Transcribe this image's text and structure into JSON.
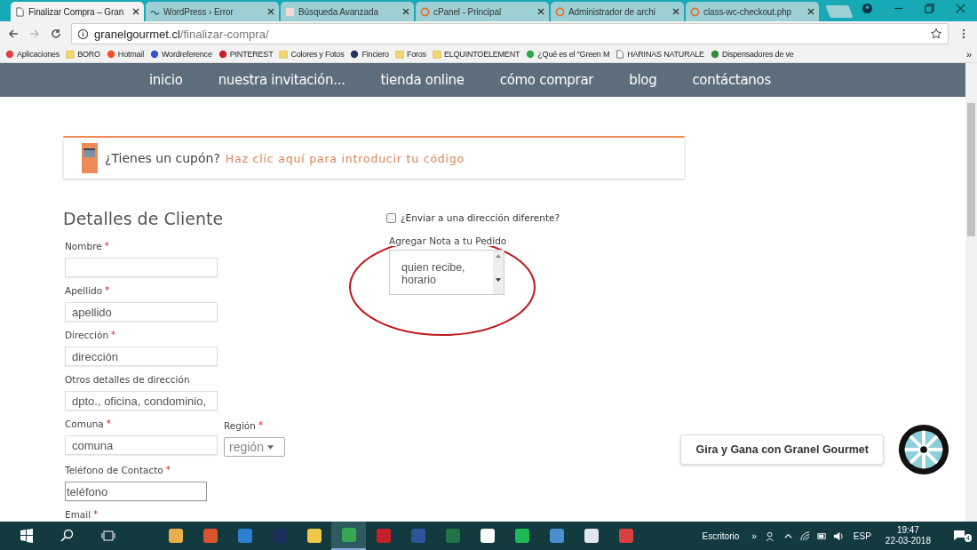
{
  "browser": {
    "tabs": [
      {
        "title": "Finalizar Compra – Gran",
        "kind": "page",
        "selected": true
      },
      {
        "title": "WordPress › Error",
        "kind": "wave",
        "selected": false
      },
      {
        "title": "Búsqueda Avanzada",
        "kind": "w",
        "selected": false
      },
      {
        "title": "cPanel - Principal",
        "kind": "cp",
        "selected": false
      },
      {
        "title": "Administrador de archi",
        "kind": "cp",
        "selected": false
      },
      {
        "title": "class-wc-checkout.php",
        "kind": "cp",
        "selected": false
      }
    ],
    "url_host": "granelgourmet.cl",
    "url_path": "/finalizar-compra/",
    "bookmarks": [
      {
        "label": "Aplicaciones",
        "kind": "apps"
      },
      {
        "label": "BORO",
        "kind": "folder"
      },
      {
        "label": "Hotmail",
        "kind": "windows"
      },
      {
        "label": "Wordreference",
        "kind": "wr"
      },
      {
        "label": "PINTEREST",
        "kind": "pin"
      },
      {
        "label": "Colores y Fotos",
        "kind": "folder"
      },
      {
        "label": "Finciero",
        "kind": "f"
      },
      {
        "label": "Foros",
        "kind": "folder"
      },
      {
        "label": "ELQUINTOELEMENT",
        "kind": "folder"
      },
      {
        "label": "¿Qué es el \"Green M",
        "kind": "circle"
      },
      {
        "label": "HARINAS NATURALE",
        "kind": "page"
      },
      {
        "label": "Dispensadores de ve",
        "kind": "green"
      }
    ],
    "bookmarks_more": "»"
  },
  "nav": [
    "inicio",
    "nuestra invitación...",
    "tienda online",
    "cómo comprar",
    "blog",
    "contáctanos"
  ],
  "coupon": {
    "question": "¿Tienes un cupón?",
    "link": "Haz clic aquí para introducir tu código"
  },
  "form": {
    "heading": "Detalles de Cliente",
    "fields": [
      {
        "label": "Nombre",
        "required_mark": "*"
      },
      {
        "label": "Apellido",
        "required_mark": "*",
        "placeholder": "apellido"
      },
      {
        "label": "Dirección",
        "required_mark": "*",
        "placeholder": "dirección"
      },
      {
        "label": "Otros detalles de dirección",
        "placeholder": "dpto., oficina, condominio,"
      }
    ],
    "comuna": {
      "label": "Comuna",
      "required_mark": "*",
      "placeholder": "comuna"
    },
    "region": {
      "label": "Región",
      "required_mark": "*",
      "value": "región"
    },
    "phone": {
      "label": "Teléfono de Contacto",
      "required_mark": "*",
      "placeholder": "teléfono"
    },
    "email": {
      "label": "Email",
      "required_mark": "*"
    },
    "ship_different": {
      "label": "¿Enviar a una dirección diferente?",
      "checked": false
    },
    "note": {
      "label": "Agregar Nota a tu Pedido",
      "value": "quien recibe, horario"
    }
  },
  "wheel_popup": {
    "text": "Gira y Gana con Granel Gourmet"
  },
  "taskbar": {
    "apps": [
      {
        "kind": "palette",
        "selected": false
      },
      {
        "kind": "orange",
        "selected": false
      },
      {
        "kind": "store",
        "selected": false
      },
      {
        "kind": "blue",
        "selected": false
      },
      {
        "kind": "folder",
        "selected": false
      },
      {
        "kind": "chrome",
        "selected": true
      },
      {
        "kind": "red",
        "selected": false
      },
      {
        "kind": "word",
        "selected": false
      },
      {
        "kind": "excel",
        "selected": false
      },
      {
        "kind": "photo",
        "selected": false
      },
      {
        "kind": "spotify",
        "selected": false
      },
      {
        "kind": "tool",
        "selected": false
      },
      {
        "kind": "list",
        "selected": false
      },
      {
        "kind": "chart",
        "selected": false
      }
    ],
    "desktop": "Escritorio",
    "more": "»",
    "lang": "ESP",
    "time": "19:47",
    "date": "22-03-2018",
    "notifications": "4"
  }
}
